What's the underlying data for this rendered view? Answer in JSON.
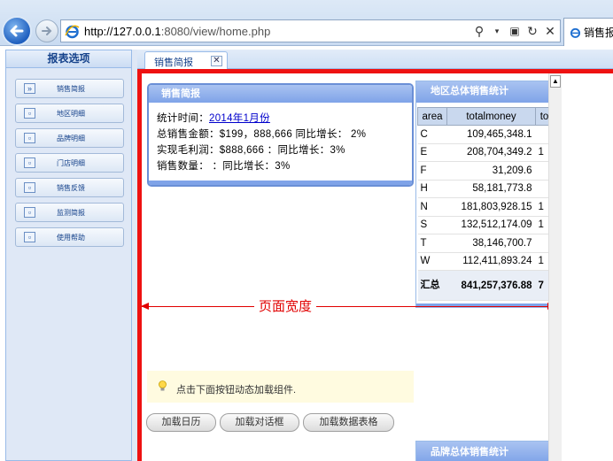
{
  "browser": {
    "url_prefix": "http://127.0.0.1",
    "url_rest": ":8080/view/home.php",
    "tab_title": "销售报"
  },
  "sidebar": {
    "title": "报表选项",
    "items": [
      {
        "label": "销售简报",
        "icon": "double-chevron-icon"
      },
      {
        "label": "地区明细",
        "icon": "window-icon"
      },
      {
        "label": "品牌明细",
        "icon": "window-icon"
      },
      {
        "label": "门店明细",
        "icon": "window-icon"
      },
      {
        "label": "销售反馈",
        "icon": "window-icon"
      },
      {
        "label": "监测简报",
        "icon": "window-icon"
      },
      {
        "label": "使用帮助",
        "icon": "window-icon"
      }
    ]
  },
  "content_tab": {
    "label": "销售简报"
  },
  "summary": {
    "title": "销售简报",
    "time_label": "统计时间：",
    "time_value": "2014年1月份",
    "line1": "总销售金额：$199，888,666 同比增长： 2%",
    "line2": "实现毛利润：$888,666 ：同比增长：3%",
    "line3": "销售数量：  ：同比增长：3%"
  },
  "region": {
    "title": "地区总体销售统计",
    "columns": [
      "area",
      "totalmoney",
      "to"
    ],
    "rows": [
      {
        "area": "C",
        "totalmoney": "109,465,348.1",
        "extra": ""
      },
      {
        "area": "E",
        "totalmoney": "208,704,349.2",
        "extra": "1"
      },
      {
        "area": "F",
        "totalmoney": "31,209.6",
        "extra": ""
      },
      {
        "area": "H",
        "totalmoney": "58,181,773.8",
        "extra": ""
      },
      {
        "area": "N",
        "totalmoney": "181,803,928.15",
        "extra": "1"
      },
      {
        "area": "S",
        "totalmoney": "132,512,174.09",
        "extra": "1"
      },
      {
        "area": "T",
        "totalmoney": "38,146,700.7",
        "extra": ""
      },
      {
        "area": "W",
        "totalmoney": "112,411,893.24",
        "extra": "1"
      }
    ],
    "total": {
      "area": "汇总",
      "totalmoney": "841,257,376.88",
      "extra": "7"
    }
  },
  "annotation": {
    "label": "页面宽度",
    "color": "#e10000"
  },
  "hint": {
    "text": "点击下面按钮动态加载组件."
  },
  "buttons": {
    "calendar": "加载日历",
    "dialog": "加载对话框",
    "table": "加载数据表格"
  },
  "brand": {
    "title": "品牌总体销售统计"
  }
}
